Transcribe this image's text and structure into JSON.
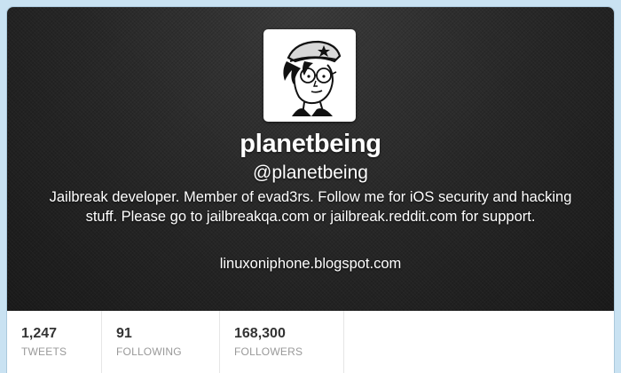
{
  "profile": {
    "name": "planetbeing",
    "handle": "@planetbeing",
    "bio": "Jailbreak developer. Member of evad3rs. Follow me for iOS security and hacking stuff. Please go to jailbreakqa.com or jailbreak.reddit.com for support.",
    "url": "linuxoniphone.blogspot.com",
    "avatar_icon": "cartoon-portrait-avatar"
  },
  "stats": [
    {
      "value": "1,247",
      "label": "TWEETS"
    },
    {
      "value": "91",
      "label": "FOLLOWING"
    },
    {
      "value": "168,300",
      "label": "FOLLOWERS"
    }
  ],
  "colors": {
    "header_bg": "#262626",
    "page_bg": "#c9e2f2",
    "stat_value": "#333333",
    "stat_label": "#999999"
  }
}
